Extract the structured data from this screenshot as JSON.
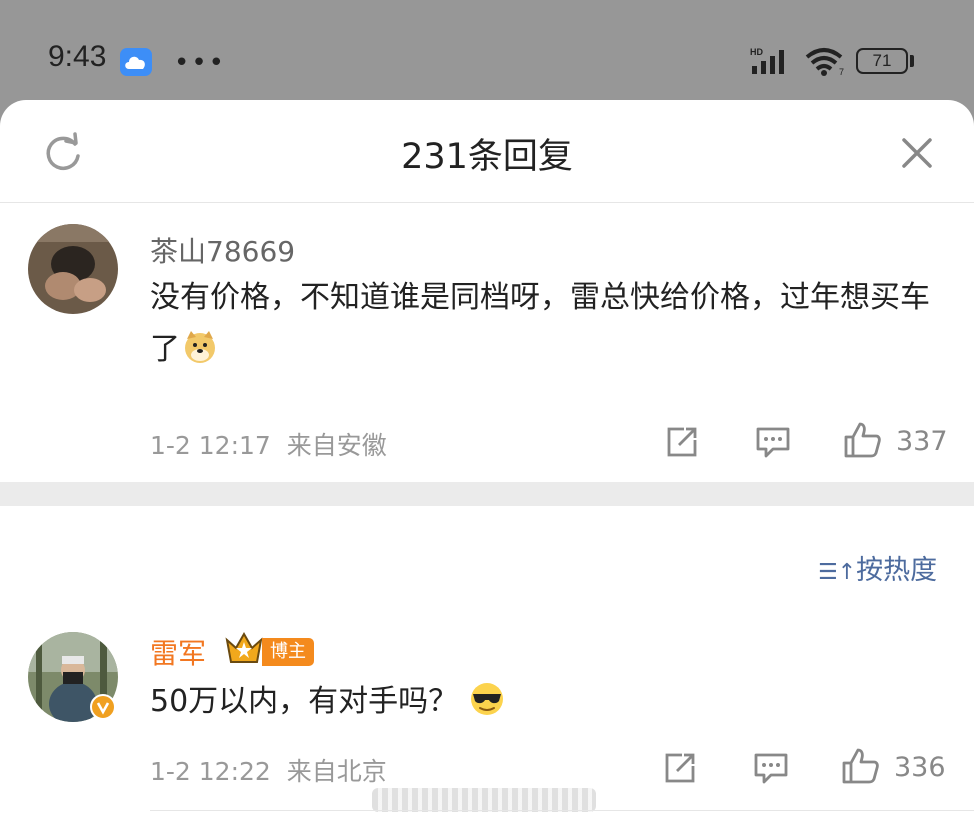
{
  "status_bar": {
    "time": "9:43",
    "dots": "•••",
    "battery": "71"
  },
  "header": {
    "title": "231条回复"
  },
  "comments": [
    {
      "username": "茶山78669",
      "text": "没有价格，不知道谁是同档呀，雷总快给价格，过年想买车了",
      "timestamp": "1-2 12:17",
      "location": "来自安徽",
      "likes": "337"
    },
    {
      "username": "雷军",
      "badge": "博主",
      "text": "50万以内，有对手吗？",
      "timestamp": "1-2 12:22",
      "location": "来自北京",
      "likes": "336"
    }
  ],
  "sort": {
    "icon": "☰↑",
    "label": "按热度"
  },
  "colors": {
    "accent_orange": "#f48a1d",
    "link_blue": "#4d6b9e",
    "username_gray": "#666666",
    "username_orange": "#f27721"
  }
}
